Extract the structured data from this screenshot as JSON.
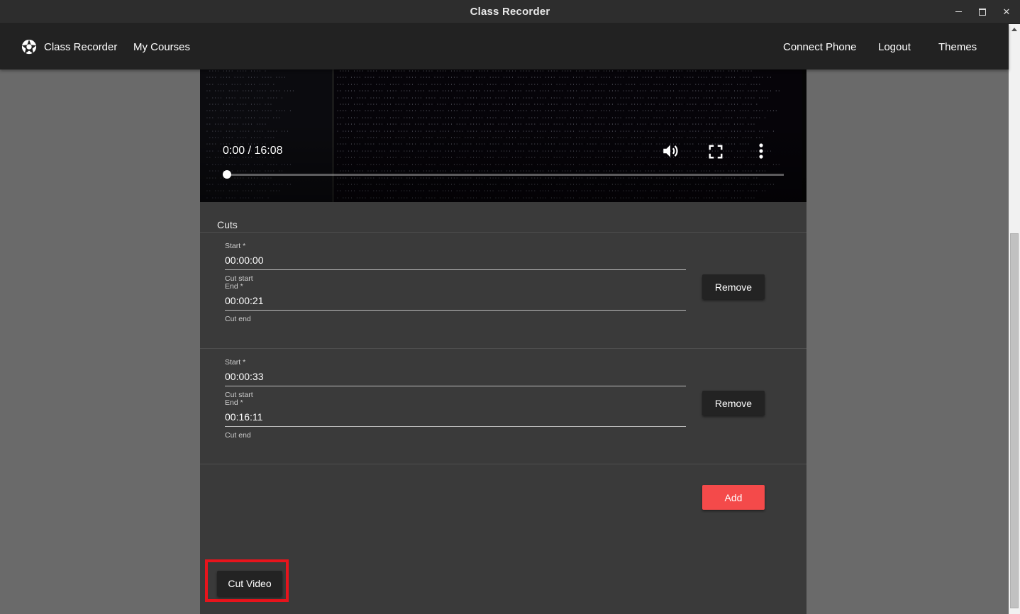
{
  "window": {
    "title": "Class Recorder"
  },
  "appbar": {
    "brand": "Class Recorder",
    "my_courses": "My Courses",
    "connect_phone": "Connect Phone",
    "logout": "Logout",
    "themes": "Themes"
  },
  "video": {
    "time": "0:00 / 16:08",
    "progress": 0,
    "icons": [
      "volume-icon",
      "fullscreen-icon",
      "more-vert-icon"
    ]
  },
  "cuts": {
    "title": "Cuts",
    "items": [
      {
        "start_label": "Start *",
        "start": "00:00:00",
        "start_hint": "Cut start",
        "end_label": "End *",
        "end": "00:00:21",
        "end_hint": "Cut end",
        "remove": "Remove"
      },
      {
        "start_label": "Start *",
        "start": "00:00:33",
        "start_hint": "Cut start",
        "end_label": "End *",
        "end": "00:16:11",
        "end_hint": "Cut end",
        "remove": "Remove"
      }
    ],
    "add": "Add"
  },
  "actions": {
    "cut_video": "Cut Video"
  },
  "colors": {
    "accent": "#f44a4a",
    "highlight": "#e8141c",
    "appbar": "#222222",
    "card": "#3a3a3a"
  }
}
